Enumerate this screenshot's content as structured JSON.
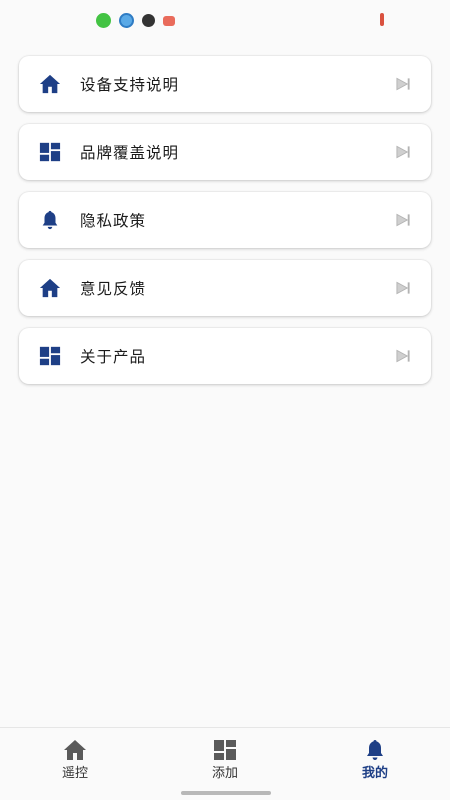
{
  "colors": {
    "accent": "#1e3f86",
    "tab_icon": "#5a5a5a",
    "arrow": "#c4c4c4"
  },
  "status_bar": {
    "icons": [
      "wechat-icon",
      "chat-bubble-icon",
      "person-icon",
      "mail-icon"
    ]
  },
  "menu": {
    "items": [
      {
        "label": "设备支持说明",
        "icon": "home-icon"
      },
      {
        "label": "品牌覆盖说明",
        "icon": "dashboard-icon"
      },
      {
        "label": "隐私政策",
        "icon": "bell-icon"
      },
      {
        "label": "意见反馈",
        "icon": "home-icon"
      },
      {
        "label": "关于产品",
        "icon": "dashboard-icon"
      }
    ]
  },
  "tabs": [
    {
      "label": "遥控",
      "icon": "home-icon",
      "active": false
    },
    {
      "label": "添加",
      "icon": "dashboard-icon",
      "active": false
    },
    {
      "label": "我的",
      "icon": "bell-icon",
      "active": true
    }
  ]
}
